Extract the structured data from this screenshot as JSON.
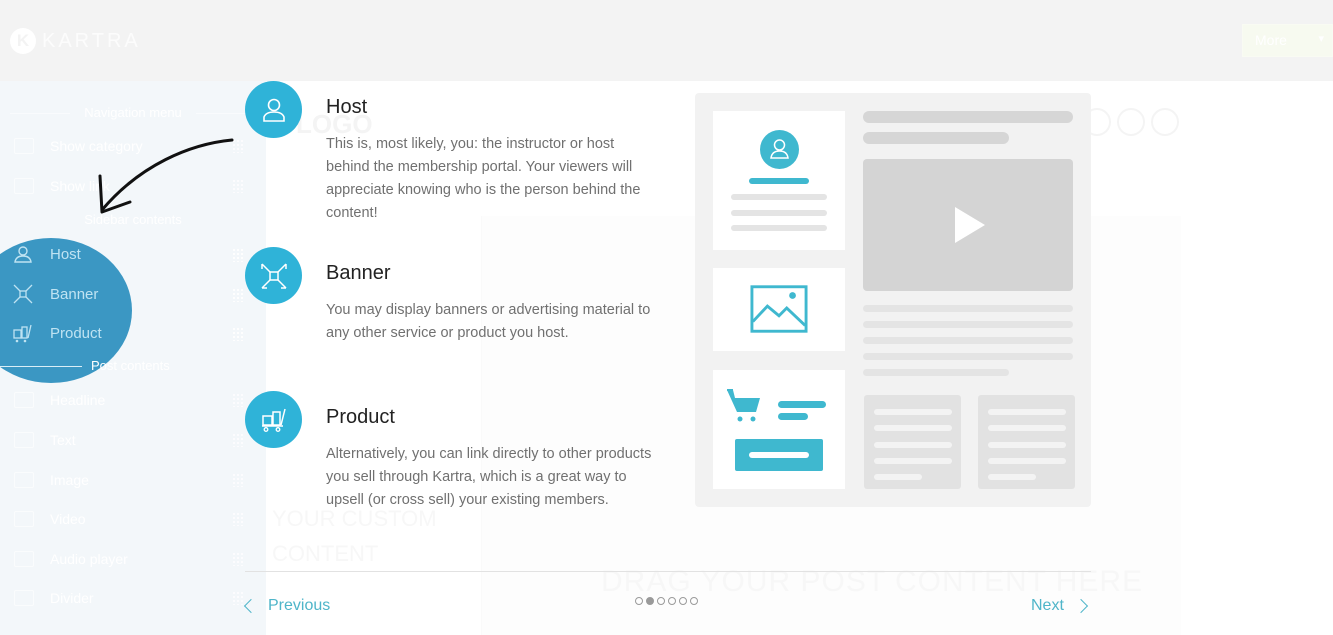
{
  "app": {
    "logo_text": "KARTRA",
    "logo_mark": "K",
    "top_button": "More",
    "canvas_ghost_logo": "LOGO",
    "drag_hint": "DRAG YOUR POST CONTENT HERE",
    "ghost_subtitle_1": "YOUR CUSTOM",
    "ghost_subtitle_2": "CONTENT"
  },
  "sidebar": {
    "headings": {
      "navigation": "Navigation menu",
      "sidebar_contents": "Sidebar contents",
      "post_contents": "Post contents"
    },
    "nav_items": [
      {
        "label": "Show category",
        "icon": "list-icon"
      },
      {
        "label": "Show link",
        "icon": "pencil-icon"
      }
    ],
    "sidebar_items": [
      {
        "label": "Host",
        "icon": "user-icon"
      },
      {
        "label": "Banner",
        "icon": "banner-compress-icon"
      },
      {
        "label": "Product",
        "icon": "cart-icon"
      }
    ],
    "post_items": [
      {
        "label": "Headline",
        "icon": "heading-icon"
      },
      {
        "label": "Text",
        "icon": "text-icon"
      },
      {
        "label": "Image",
        "icon": "image-icon"
      },
      {
        "label": "Video",
        "icon": "video-icon"
      },
      {
        "label": "Audio player",
        "icon": "audio-icon"
      },
      {
        "label": "Divider",
        "icon": "divider-icon"
      }
    ]
  },
  "tour": {
    "features": [
      {
        "title": "Host",
        "icon": "user-icon",
        "description": "This is, most likely, you: the instructor or host behind the membership portal. Your viewers will appreciate knowing who is the person behind the content!"
      },
      {
        "title": "Banner",
        "icon": "banner-compress-icon",
        "description": "You may display banners or advertising material to any other service or product you host."
      },
      {
        "title": "Product",
        "icon": "cart-icon",
        "description": "Alternatively, you can link directly to other products you sell through Kartra, which is a great way to upsell (or cross sell) your existing members."
      }
    ],
    "previous_label": "Previous",
    "next_label": "Next",
    "pagination": {
      "total": 6,
      "current": 2
    },
    "colors": {
      "accent": "#2fb3d8",
      "link": "#4fb5c9",
      "spotlight": "#3b97c3"
    }
  }
}
